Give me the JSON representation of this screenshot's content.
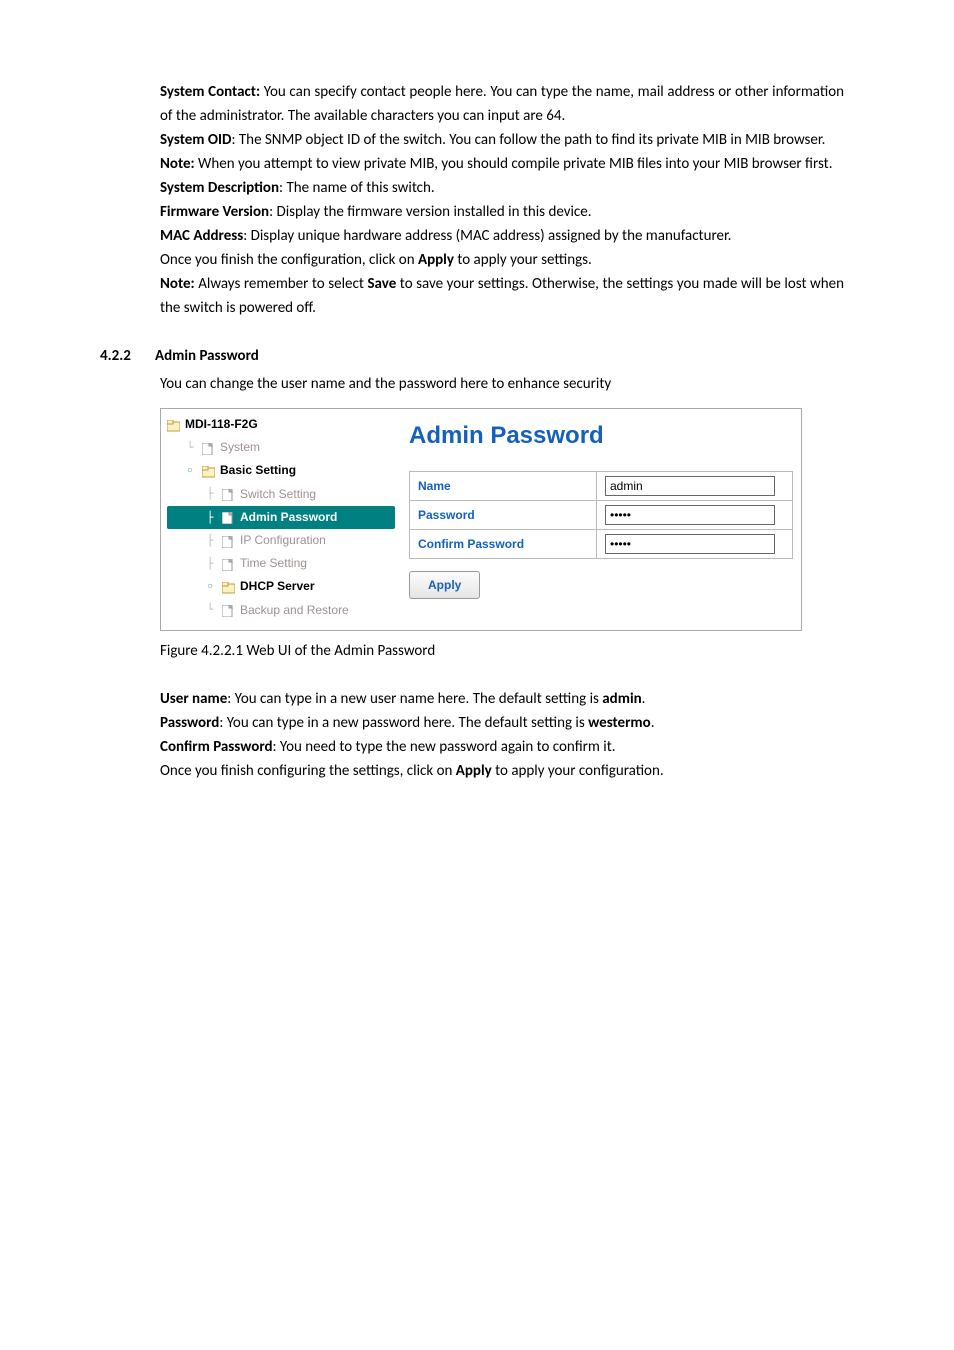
{
  "para1": {
    "lead": "System Contact:",
    "text": " You can specify contact people here. You can type the name, mail address or other information of the administrator. The available characters you can input are 64."
  },
  "para2": {
    "lead": "System OID",
    "text": ": The SNMP object ID of the switch. You can follow the path to find its private MIB in MIB browser."
  },
  "para3": {
    "lead": "Note:",
    "text": " When you attempt to view private MIB, you should compile private MIB files into your MIB browser first."
  },
  "para4": {
    "lead": "System Description",
    "text": ": The name of this switch."
  },
  "para5": {
    "lead": "Firmware Version",
    "text": ": Display the firmware version installed in this device."
  },
  "para6": {
    "lead": "MAC Address",
    "text": ": Display unique hardware address (MAC address) assigned by the manufacturer."
  },
  "para7": {
    "pre": "Once you finish the configuration, click on ",
    "mid": "Apply",
    "post": " to apply your settings."
  },
  "para8": {
    "lead": "Note:",
    "mid1": " Always remember to select ",
    "save": "Save",
    "post": " to save your settings. Otherwise, the settings you made will be lost when the switch is powered off."
  },
  "section": {
    "num": "4.2.2",
    "title": "Admin Password",
    "intro": "You can change the user name and the password here to enhance security"
  },
  "ui": {
    "root": "MDI-118-F2G",
    "tree": {
      "system": "System",
      "basic": "Basic Setting",
      "switch": "Switch Setting",
      "adminpw": "Admin Password",
      "ipconf": "IP Configuration",
      "time": "Time Setting",
      "dhcp": "DHCP Server",
      "backup": "Backup and Restore"
    },
    "panelTitle": "Admin Password",
    "form": {
      "nameLabel": "Name",
      "nameValue": "admin",
      "pwLabel": "Password",
      "pwValue": "•••••",
      "cpwLabel": "Confirm Password",
      "cpwValue": "•••••"
    },
    "apply": "Apply"
  },
  "figcap": "Figure 4.2.2.1 Web UI of the Admin Password",
  "para9": {
    "lead": "User name",
    "mid": ": You can type in a new user name here. The default setting is ",
    "tail": "admin",
    "dot": "."
  },
  "para10": {
    "lead": "Password",
    "mid": ": You can type in a new password here. The default setting is ",
    "tail": "westermo",
    "dot": "."
  },
  "para11": {
    "lead": "Confirm Password",
    "text": ": You need to type the new password again to confirm it."
  },
  "para12": {
    "pre": "Once you finish configuring the settings, click on ",
    "mid": "Apply",
    "post": " to apply your configuration."
  }
}
